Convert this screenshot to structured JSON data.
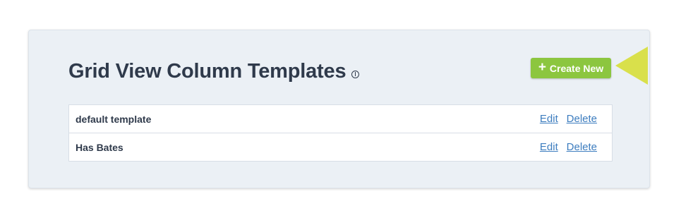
{
  "page": {
    "title": "Grid View Column Templates",
    "info_icon": "info-circle-icon"
  },
  "create_button": {
    "icon": "plus-icon",
    "plus_glyph": "+",
    "label": "Create New"
  },
  "templates": [
    {
      "name": "default template",
      "edit_label": "Edit",
      "delete_label": "Delete"
    },
    {
      "name": "Has Bates",
      "edit_label": "Edit",
      "delete_label": "Delete"
    }
  ],
  "colors": {
    "accent_green": "#8cc63f",
    "highlight_arrow": "#d9e04b",
    "link_blue": "#3d7dbf",
    "panel_bg": "#ebf0f5"
  }
}
